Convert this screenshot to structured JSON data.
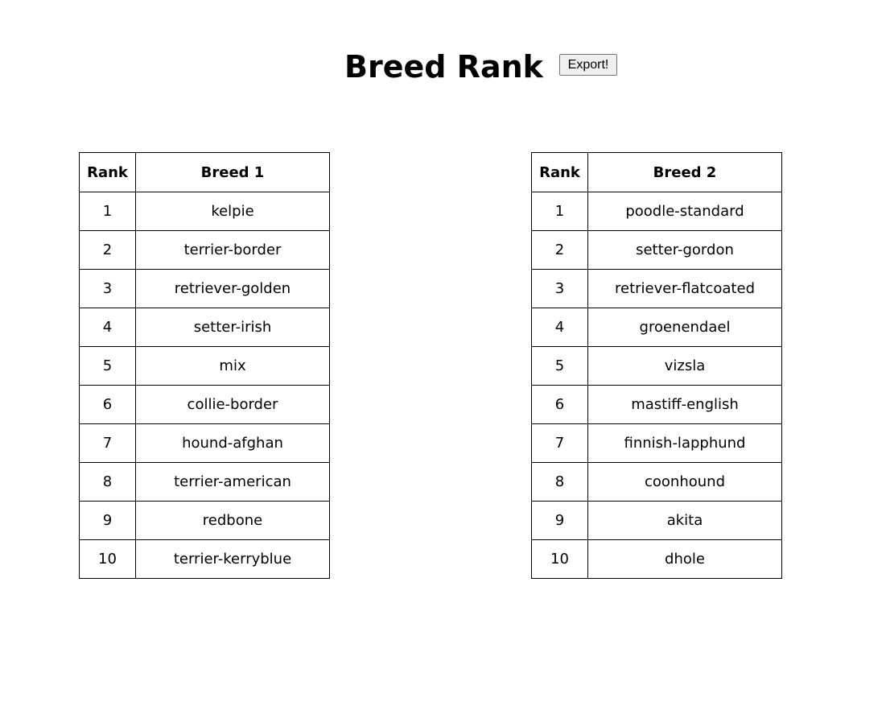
{
  "header": {
    "title": "Breed Rank",
    "export_label": "Export!"
  },
  "tables": [
    {
      "rank_header": "Rank",
      "breed_header": "Breed 1",
      "rows": [
        {
          "rank": "1",
          "breed": "kelpie"
        },
        {
          "rank": "2",
          "breed": "terrier-border"
        },
        {
          "rank": "3",
          "breed": "retriever-golden"
        },
        {
          "rank": "4",
          "breed": "setter-irish"
        },
        {
          "rank": "5",
          "breed": "mix"
        },
        {
          "rank": "6",
          "breed": "collie-border"
        },
        {
          "rank": "7",
          "breed": "hound-afghan"
        },
        {
          "rank": "8",
          "breed": "terrier-american"
        },
        {
          "rank": "9",
          "breed": "redbone"
        },
        {
          "rank": "10",
          "breed": "terrier-kerryblue"
        }
      ]
    },
    {
      "rank_header": "Rank",
      "breed_header": "Breed 2",
      "rows": [
        {
          "rank": "1",
          "breed": "poodle-standard"
        },
        {
          "rank": "2",
          "breed": "setter-gordon"
        },
        {
          "rank": "3",
          "breed": "retriever-flatcoated"
        },
        {
          "rank": "4",
          "breed": "groenendael"
        },
        {
          "rank": "5",
          "breed": "vizsla"
        },
        {
          "rank": "6",
          "breed": "mastiff-english"
        },
        {
          "rank": "7",
          "breed": "finnish-lapphund"
        },
        {
          "rank": "8",
          "breed": "coonhound"
        },
        {
          "rank": "9",
          "breed": "akita"
        },
        {
          "rank": "10",
          "breed": "dhole"
        }
      ]
    }
  ]
}
